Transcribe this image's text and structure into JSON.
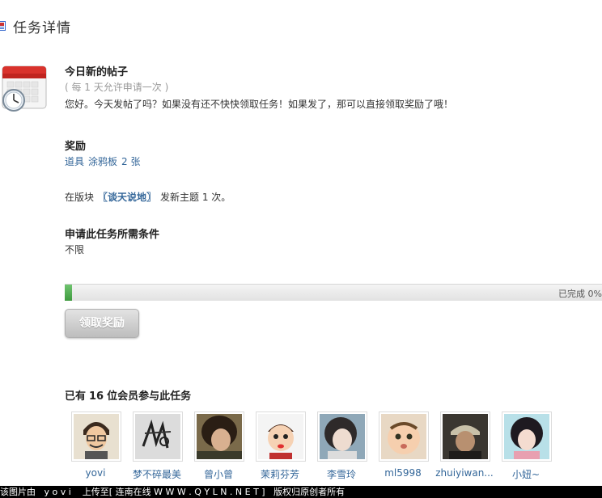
{
  "header": {
    "title": "任务详情"
  },
  "task": {
    "name": "今日新的帖子",
    "frequency": "( 每 1 天允许申请一次 )",
    "description": "您好。今天发帖了吗？如果没有还不快快领取任务！如果发了，那可以直接领取奖励了哦！"
  },
  "reward": {
    "heading": "奖励",
    "type": "道具",
    "item": "涂鸦板",
    "quantity": "2 张"
  },
  "condition": {
    "prefix": "在版块",
    "forum": "〖谈天说地〗",
    "suffix": "发新主题 1 次。"
  },
  "requirements": {
    "heading": "申请此任务所需条件",
    "value": "不限"
  },
  "progress": {
    "percent": 1.3,
    "label": "已完成 0%"
  },
  "claim_button": {
    "label": "领取奖励"
  },
  "members": {
    "prefix": "已有",
    "count": "16",
    "suffix": "位会员参与此任务",
    "list": [
      {
        "name": "yovi"
      },
      {
        "name": "梦不碎最美"
      },
      {
        "name": "曾小曾"
      },
      {
        "name": "茉莉芬芳"
      },
      {
        "name": "李雪玲"
      },
      {
        "name": "ml5998"
      },
      {
        "name": "zhuiyiwan..."
      },
      {
        "name": "小妞~"
      }
    ]
  },
  "footer": {
    "text1": "该图片由",
    "uploader": "y o v i",
    "text2": "上传至",
    "site": "[ 连南在线 W W W . Q Y L N . N E T ]",
    "text3": "版权归原创者所有"
  },
  "colors": {
    "link": "#336699",
    "progress": "#3e9a3e",
    "button": "#c8c8c8"
  }
}
